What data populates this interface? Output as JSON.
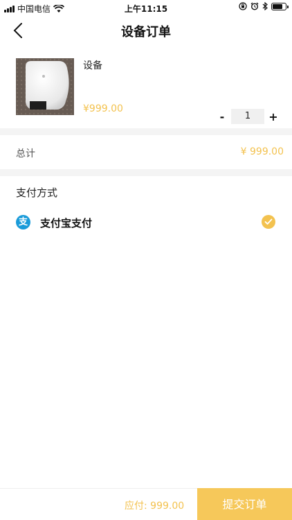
{
  "status_bar": {
    "carrier": "中国电信",
    "time": "上午11:15"
  },
  "nav": {
    "title": "设备订单"
  },
  "product": {
    "name": "设备",
    "price": "¥999.00",
    "quantity": "1",
    "minus": "-",
    "plus": "+"
  },
  "summary": {
    "total_label": "总计",
    "total_value": "¥ 999.00"
  },
  "payment": {
    "header": "支付方式",
    "alipay_label": "支付宝支付",
    "alipay_icon_char": "支",
    "selected": true
  },
  "footer": {
    "due_text": "应付:  999.00",
    "submit_label": "提交订单"
  },
  "colors": {
    "accent": "#f3c24f",
    "submit_bg": "#f6c85a",
    "alipay": "#1a9bd9"
  }
}
